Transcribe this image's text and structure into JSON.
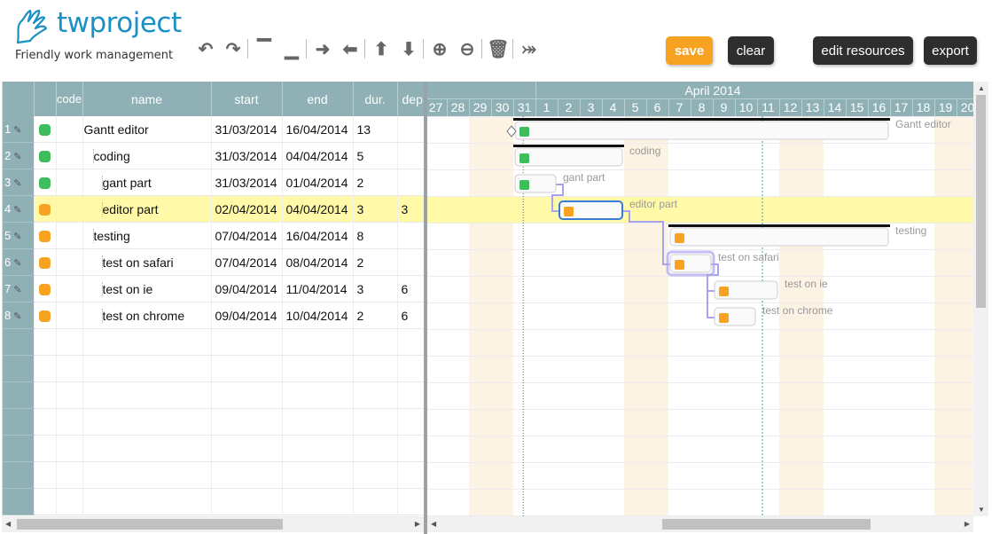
{
  "header": {
    "brand": "twproject",
    "tagline": "Friendly work management"
  },
  "toolbar": {
    "tools": [
      {
        "name": "undo-icon",
        "glyph": "↶",
        "sep": false
      },
      {
        "name": "redo-icon",
        "glyph": "↷",
        "sep": true
      },
      {
        "name": "insert-above-icon",
        "glyph": "▔",
        "sep": false
      },
      {
        "name": "insert-below-icon",
        "glyph": "▁",
        "sep": true
      },
      {
        "name": "indent-icon",
        "glyph": "➜",
        "sep": false
      },
      {
        "name": "outdent-icon",
        "glyph": "⬅",
        "sep": true
      },
      {
        "name": "move-up-icon",
        "glyph": "⬆",
        "sep": false
      },
      {
        "name": "move-down-icon",
        "glyph": "⬇",
        "sep": true
      },
      {
        "name": "zoom-in-icon",
        "glyph": "⊕",
        "sep": false
      },
      {
        "name": "zoom-out-icon",
        "glyph": "⊖",
        "sep": true
      },
      {
        "name": "delete-icon",
        "glyph": "🗑",
        "sep": true
      },
      {
        "name": "critical-path-icon",
        "glyph": "⤖",
        "sep": false
      }
    ],
    "save_label": "save",
    "clear_label": "clear",
    "edit_resources_label": "edit resources",
    "export_label": "export"
  },
  "grid": {
    "columns": [
      "code",
      "name",
      "start",
      "end",
      "dur.",
      "dep"
    ],
    "rows": [
      {
        "num": "1",
        "status": "green",
        "name": "Gantt editor",
        "indent": 0,
        "start": "31/03/2014",
        "end": "16/04/2014",
        "dur": "13",
        "dep": "",
        "dimStart": false,
        "selected": false
      },
      {
        "num": "2",
        "status": "green",
        "name": "coding",
        "indent": 1,
        "start": "31/03/2014",
        "end": "04/04/2014",
        "dur": "5",
        "dep": "",
        "dimStart": false,
        "selected": false
      },
      {
        "num": "3",
        "status": "green",
        "name": "gant part",
        "indent": 2,
        "start": "31/03/2014",
        "end": "01/04/2014",
        "dur": "2",
        "dep": "",
        "dimStart": false,
        "selected": false
      },
      {
        "num": "4",
        "status": "orange",
        "name": "editor part",
        "indent": 2,
        "start": "02/04/2014",
        "end": "04/04/2014",
        "dur": "3",
        "dep": "3",
        "dimStart": true,
        "selected": true
      },
      {
        "num": "5",
        "status": "orange",
        "name": "testing",
        "indent": 1,
        "start": "07/04/2014",
        "end": "16/04/2014",
        "dur": "8",
        "dep": "",
        "dimStart": true,
        "selected": false
      },
      {
        "num": "6",
        "status": "orange",
        "name": "test on safari",
        "indent": 2,
        "start": "07/04/2014",
        "end": "08/04/2014",
        "dur": "2",
        "dep": "",
        "dimStart": true,
        "selected": false
      },
      {
        "num": "7",
        "status": "orange",
        "name": "test on ie",
        "indent": 2,
        "start": "09/04/2014",
        "end": "11/04/2014",
        "dur": "3",
        "dep": "6",
        "dimStart": true,
        "selected": false
      },
      {
        "num": "8",
        "status": "orange",
        "name": "test on chrome",
        "indent": 2,
        "start": "09/04/2014",
        "end": "10/04/2014",
        "dur": "2",
        "dep": "6",
        "dimStart": true,
        "selected": false
      }
    ]
  },
  "gantt": {
    "month_label": "April 2014",
    "days": [
      "27",
      "28",
      "29",
      "30",
      "31",
      "1",
      "2",
      "3",
      "4",
      "5",
      "6",
      "7",
      "8",
      "9",
      "10",
      "11",
      "12",
      "13",
      "14",
      "15",
      "16",
      "17",
      "18",
      "19",
      "20"
    ],
    "weekend_days": [
      "29",
      "30",
      "5",
      "6",
      "12",
      "13",
      "19",
      "20"
    ],
    "today_day": "31",
    "today_offset": 0.45,
    "tasks": [
      {
        "label": "Gantt editor",
        "start": "31",
        "dur": 17,
        "status": "green",
        "summary": true,
        "milestone": true
      },
      {
        "label": "coding",
        "start": "31",
        "dur": 5,
        "status": "green",
        "summary": true
      },
      {
        "label": "gant part",
        "start": "31",
        "dur": 2,
        "status": "green"
      },
      {
        "label": "editor part",
        "start": "2",
        "dur": 3,
        "status": "orange",
        "selected": true
      },
      {
        "label": "testing",
        "start": "7",
        "dur": 10,
        "status": "orange",
        "summary": true
      },
      {
        "label": "test on safari",
        "start": "7",
        "dur": 2,
        "status": "orange",
        "linked": true
      },
      {
        "label": "test on ie",
        "start": "9",
        "dur": 3,
        "status": "orange"
      },
      {
        "label": "test on chrome",
        "start": "9",
        "dur": 2,
        "status": "orange"
      }
    ],
    "links": [
      [
        2,
        3
      ],
      [
        3,
        5
      ],
      [
        5,
        6
      ],
      [
        5,
        7
      ]
    ]
  },
  "colors": {
    "green": "#3ebd5d",
    "orange": "#f7a321",
    "header": "#8fb1b6",
    "selected_row": "#fff9a8",
    "weekend": "#fdf3e4",
    "link": "#a9a3ee"
  }
}
